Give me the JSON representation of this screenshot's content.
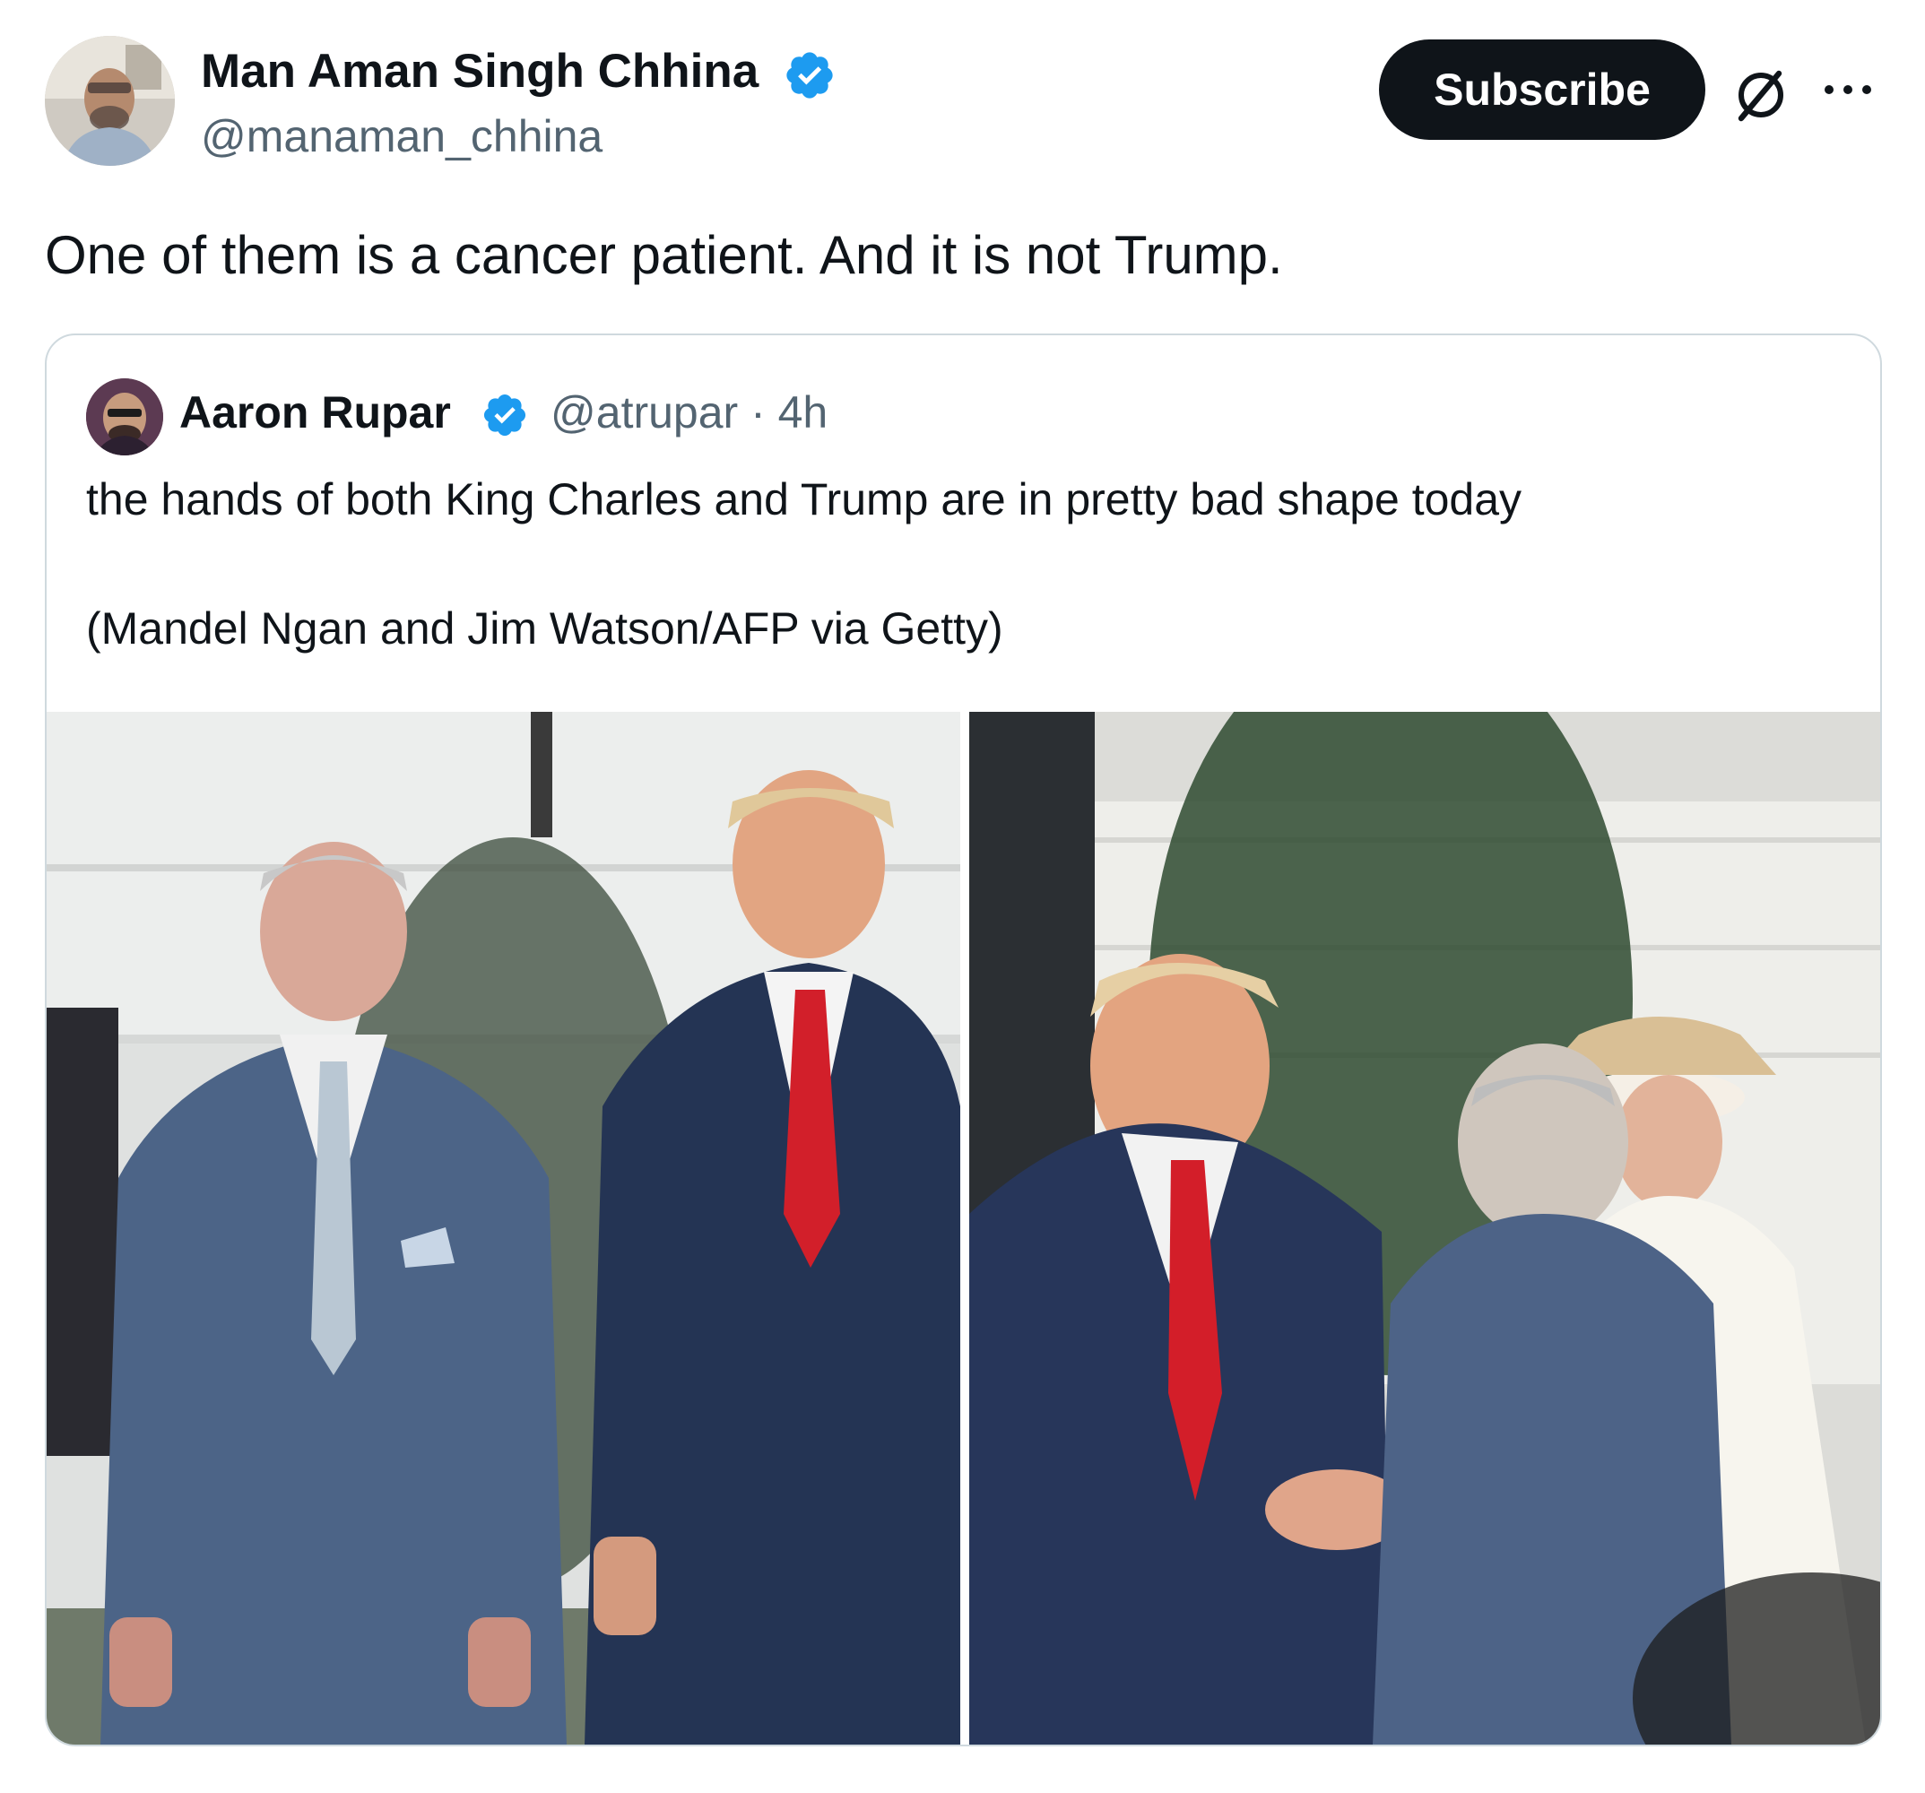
{
  "tweet": {
    "author_name": "Man Aman Singh Chhina",
    "author_handle": "@manaman_chhina",
    "subscribe_label": "Subscribe",
    "text": "One of them is a cancer patient. And it is not Trump."
  },
  "quoted_tweet": {
    "author_name": "Aaron Rupar",
    "author_handle_time": "@atrupar · 4h",
    "text_line1": "the hands of both King Charles and Trump are in pretty bad shape today",
    "text_line2": "(Mandel Ngan and Jim Watson/AFP via Getty)"
  },
  "icons": {
    "verified": "verified-badge-icon",
    "grok": "grok-icon",
    "more": "more-options-icon"
  },
  "colors": {
    "verified_blue": "#1d9bf0",
    "subscribe_bg": "#0f1419",
    "handle_gray": "#536471",
    "border": "#cfd9de"
  }
}
